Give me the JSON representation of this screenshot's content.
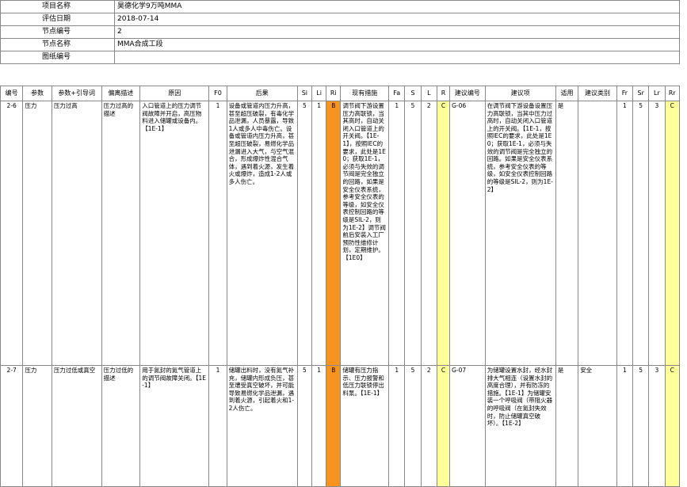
{
  "header": {
    "project_label": "项目名称",
    "project_value": "昊德化学9万吨MMA",
    "date_label": "评估日期",
    "date_value": "2018-07-14",
    "node_no_label": "节点编号",
    "node_no_value": "2",
    "node_name_label": "节点名称",
    "node_name_value": "MMA合成工段",
    "drawing_label": "图纸编号",
    "drawing_value": ""
  },
  "columns": [
    "编号",
    "参数",
    "参数+引导词",
    "偏离描述",
    "原因",
    "F0",
    "后果",
    "Si",
    "Li",
    "Ri",
    "现有措施",
    "Fa",
    "S",
    "L",
    "R",
    "建议编号",
    "建议项",
    "适用",
    "建议类别",
    "Fr",
    "Sr",
    "Lr",
    "Rr"
  ],
  "rows": [
    {
      "id": "2-6",
      "param": "压力",
      "guide": "压力过高",
      "deviation": "压力过高的描述",
      "cause": "入口管道上的压力调节阀故障并开启，高压物料进入储罐或设备内。【1E-1】",
      "f0": "1",
      "consequence": "设备或管道内压力升高，甚至超压破裂，有毒化学品泄漏，人员暴露，导致1人或多人中毒伤亡。设备或管道内压力升高，甚至超压破裂，易燃化学品泄漏进入大气，与空气混合，形成爆炸性混合气体，遇到着火源，发生着火或爆炸，造成1-2人或多人伤亡。",
      "si": "5",
      "li": "1",
      "ri": "B",
      "measures": "调节阀下游设置压力高联锁，当其高时，自动关闭入口管道上的开关阀。【1E-1】，按照IEC的要求，此处是1E0；获取1E-1，必须与失效的调节阀是完全独立的回路，如果是安全仪表系统，参考安全仪表的等级，如安全仪表控制回路的等级是SIL-2，则为1E-2】调节阀前后安装入工厂预防性维修计划，定期维护。【1E0】",
      "fa": "1",
      "s": "5",
      "l": "2",
      "r": "C",
      "rec_no": "G-06",
      "recommendation": "在调节阀下游设备设置压力高联锁，当其中压力过高时，自动关闭入口管道上的开关阀。【1E-1，按照IEC的要求，此处是1E0；获取1E-1，必须与失效的调节阀是完全独立的回路。如果是安全仪表系统，参考安全仪表的等级，如安全仪表控制回路的等级是SIL-2，则为1E-2】",
      "applicable": "是",
      "rec_type": "",
      "fr": "1",
      "sr": "5",
      "lr": "3",
      "rr": "C"
    },
    {
      "id": "2-7",
      "param": "压力",
      "guide": "压力过低或真空",
      "deviation": "压力过低的描述",
      "cause": "用于氮封的氮气管道上的调节阀故障关闭。【1E-1】",
      "f0": "1",
      "consequence": "储罐出料时，没有氮气补充，储罐内形成负压，甚至遭受真空破坏，并可能导致易燃化学品泄漏，遇到着火源，引起着火和1-2人伤亡。",
      "si": "5",
      "li": "1",
      "ri": "B",
      "measures": "储罐有压力指示、压力报警和低压力联锁停出料泵。【1E-1】",
      "fa": "1",
      "s": "5",
      "l": "2",
      "r": "C",
      "rec_no": "G-07",
      "recommendation": "为储罐设置水封，经水封排大气相连（设置水封的高度合理），并有防冻的措施。【1E-1】为储罐安装一个呼吸阀（带阻火器的呼吸阀（在氮封失效时，防止储罐真空破坏）。【1E-2】",
      "applicable": "是",
      "rec_type": "安全",
      "fr": "1",
      "sr": "5",
      "lr": "3",
      "rr": "C"
    }
  ]
}
